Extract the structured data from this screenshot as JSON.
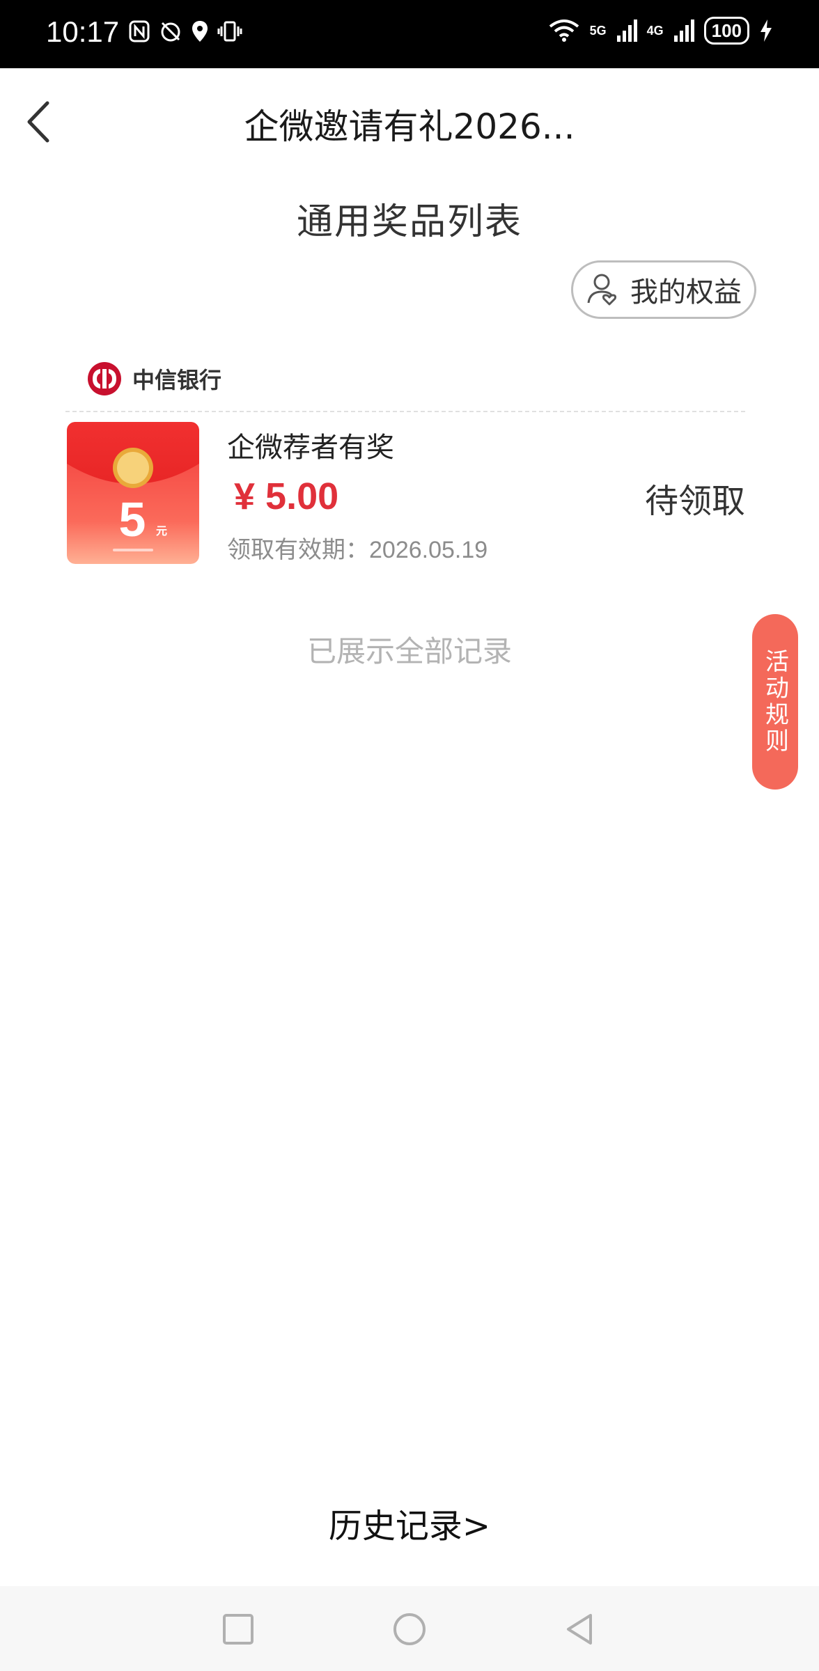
{
  "status_bar": {
    "time": "10:17",
    "network_5g": "5G",
    "network_4g": "4G",
    "battery": "100"
  },
  "header": {
    "title": "企微邀请有礼2026..."
  },
  "section_title": "通用奖品列表",
  "benefits_button": {
    "label": "我的权益"
  },
  "bank": {
    "name": "中信银行",
    "logo_color": "#c8102e"
  },
  "prize": {
    "name": "企微荐者有奖",
    "price": "¥ 5.00",
    "validity_label": "领取有效期：",
    "validity_date": "2026.05.19",
    "status": "待领取",
    "thumb_amount": "5",
    "thumb_unit": "元"
  },
  "list_end_text": "已展示全部记录",
  "rules_tab": {
    "label": "活动规则",
    "color": "#f4695a"
  },
  "history_link": "历史记录>",
  "accent_color": "#e0303a"
}
